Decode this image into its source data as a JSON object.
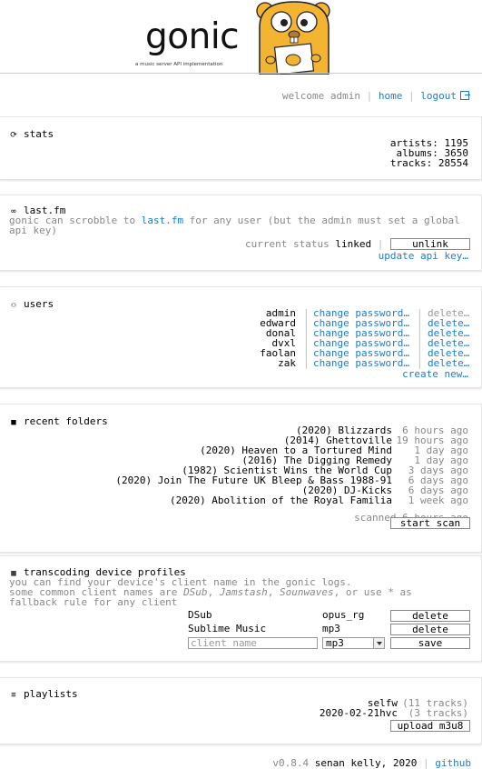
{
  "header": {
    "logo_text": "gonic",
    "logo_subtitle": "a music server API implementation"
  },
  "nav": {
    "welcome": "welcome admin",
    "home": "home",
    "logout": "logout"
  },
  "stats": {
    "title": "stats",
    "artists": "artists:  1195",
    "albums": "albums:  3650",
    "tracks": "tracks: 28554"
  },
  "lastfm": {
    "title": "last.fm",
    "desc_pre": "gonic can scrobble to ",
    "desc_link": "last.fm",
    "desc_post": " for any user (but the admin must set a global api key)",
    "status_label": "current status",
    "status_value": "linked",
    "unlink": "unlink",
    "update_key": "update api key…"
  },
  "users": {
    "title": "users",
    "change_label": "change password…",
    "delete_label": "delete…",
    "list": [
      {
        "name": "admin"
      },
      {
        "name": "edward"
      },
      {
        "name": "donal"
      },
      {
        "name": "dvxl"
      },
      {
        "name": "faolan"
      },
      {
        "name": "zak"
      }
    ],
    "create": "create new…"
  },
  "folders": {
    "title": "recent folders",
    "list": [
      {
        "name": "(2020) Blizzards",
        "age": "6 hours ago"
      },
      {
        "name": "(2014) Ghettoville",
        "age": "19 hours ago"
      },
      {
        "name": "(2020) Heaven to a Tortured Mind",
        "age": "1 day ago"
      },
      {
        "name": "(2016) The Digging Remedy",
        "age": "1 day ago"
      },
      {
        "name": "(1982) Scientist Wins the World Cup",
        "age": "3 days ago"
      },
      {
        "name": "(2020) Join The Future UK Bleep & Bass 1988-91",
        "age": "6 days ago"
      },
      {
        "name": "(2020) DJ-Kicks",
        "age": "6 days ago"
      },
      {
        "name": "(2020) Abolition of the Royal Familia",
        "age": "1 week ago"
      }
    ],
    "scanned": "scanned 6 hours ago",
    "start_scan": "start scan"
  },
  "transcode": {
    "title": "transcoding device profiles",
    "line1": "you can find your device's client name in the gonic logs.",
    "line2_pre": "some common client names are ",
    "c1": "DSub",
    "comma1": ", ",
    "c2": "Jamstash",
    "comma2": ", ",
    "c3": "Sounwaves",
    "line2_post": ", or use * as",
    "line3": "fallback rule for any client",
    "profiles": [
      {
        "client": "DSub",
        "profile": "opus_rg",
        "action": "delete"
      },
      {
        "client": "Sublime Music",
        "profile": "mp3",
        "action": "delete"
      }
    ],
    "new_placeholder": "client name",
    "new_profile": "mp3",
    "save": "save"
  },
  "playlists": {
    "title": "playlists",
    "list": [
      {
        "name": "selfw",
        "count": "(11 tracks)"
      },
      {
        "name": "2020-02-21hvc",
        "count": "(3 tracks)"
      }
    ],
    "upload": "upload m3u8"
  },
  "footer": {
    "version": "v0.8.4",
    "author": "senan kelly, 2020",
    "github": "github"
  }
}
